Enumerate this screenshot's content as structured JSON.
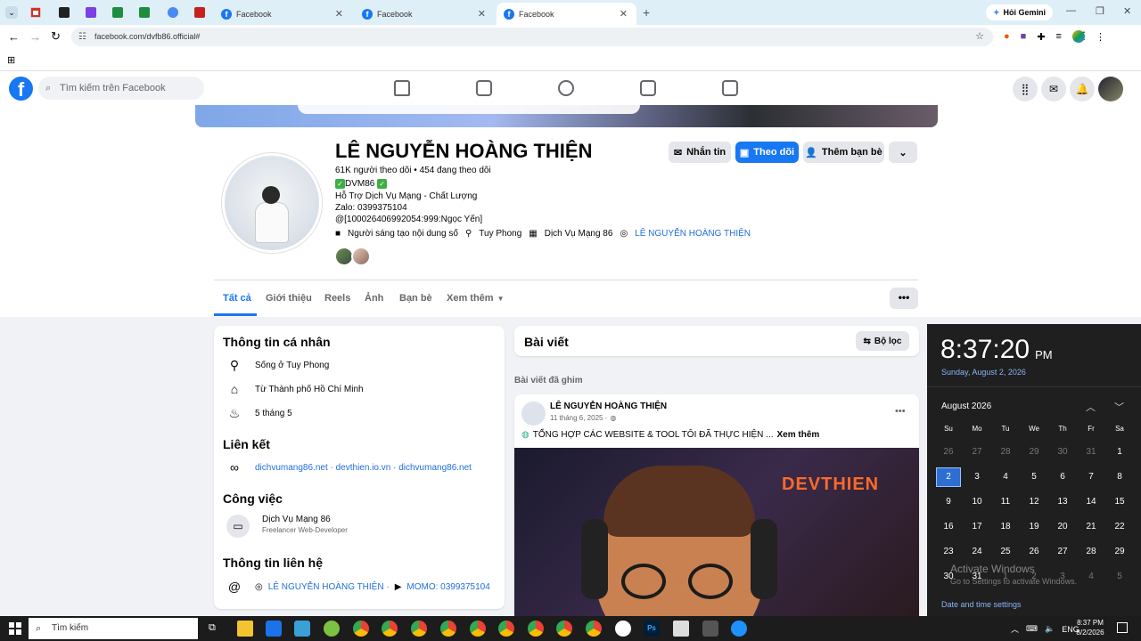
{
  "browser": {
    "tabs": [
      {
        "title": "Facebook",
        "active": false
      },
      {
        "title": "Facebook",
        "active": false
      },
      {
        "title": "Facebook",
        "active": true
      }
    ],
    "gemini_label": "Hỏi Gemini",
    "url": "facebook.com/dvfb86.official#"
  },
  "fb": {
    "search_placeholder": "Tìm kiếm trên Facebook"
  },
  "profile": {
    "name": "LÊ NGUYỄN HOÀNG THIỆN",
    "followers": "61K người theo dõi • 454 đang theo dõi",
    "bio_brand": "DVM86",
    "bio_line2": "Hỗ Trợ Dịch Vụ Mạng - Chất Lượng",
    "bio_line3": "Zalo: 0399375104",
    "bio_line4": "@[100026406992054:999:Ngọc Yến]",
    "meta_creator": "Người sáng tạo nội dung số",
    "meta_place": "Tuy Phong",
    "meta_business": "Dịch Vụ Mạng 86",
    "meta_instagram": "LÊ NGUYỄN HOÀNG THIỆN",
    "btn_message": "Nhắn tin",
    "btn_follow": "Theo dõi",
    "btn_add_friend": "Thêm bạn bè",
    "tabs": [
      "Tất cả",
      "Giới thiệu",
      "Reels",
      "Ảnh",
      "Bạn bè",
      "Xem thêm"
    ],
    "more_dots": "•••"
  },
  "intro": {
    "title": "Thông tin cá nhân",
    "lives": "Sống ở Tuy Phong",
    "from": "Từ Thành phố Hồ Chí Minh",
    "birthday": "5 tháng 5",
    "links_title": "Liên kết",
    "links": "dichvumang86.net · devthien.io.vn · dichvumang86.net",
    "work_title": "Công việc",
    "work_name": "Dịch Vụ Mạng 86",
    "work_role": "Freelancer Web-Developer",
    "contact_title": "Thông tin liên hệ",
    "contact_instagram": "LÊ NGUYỄN HOÀNG THIỆN ·",
    "contact_momo": "MOMO: 0399375104"
  },
  "posts": {
    "title": "Bài viết",
    "filter": "Bộ lọc",
    "pinned_label": "Bài viết đã ghim",
    "author": "LÊ NGUYỄN HOÀNG THIỆN",
    "date": "11 tháng 6, 2025 ·",
    "text": "TỔNG HỢP CÁC WEBSITE & TOOL TÔI ĐÃ THỰC HIỆN ...",
    "see_more": "Xem thêm",
    "image_text": "DEVTHIEN",
    "dots": "•••"
  },
  "clock": {
    "time": "8:37:20",
    "ampm": "PM",
    "date": "Sunday, August 2, 2026",
    "month": "August 2026",
    "weekdays": [
      "Su",
      "Mo",
      "Tu",
      "We",
      "Th",
      "Fr",
      "Sa"
    ],
    "rows": [
      [
        "26",
        "27",
        "28",
        "29",
        "30",
        "31",
        "1"
      ],
      [
        "2",
        "3",
        "4",
        "5",
        "6",
        "7",
        "8"
      ],
      [
        "9",
        "10",
        "11",
        "12",
        "13",
        "14",
        "15"
      ],
      [
        "16",
        "17",
        "18",
        "19",
        "20",
        "21",
        "22"
      ],
      [
        "23",
        "24",
        "25",
        "26",
        "27",
        "28",
        "29"
      ],
      [
        "30",
        "31",
        "1",
        "2",
        "3",
        "4",
        "5"
      ]
    ],
    "activate_title": "Activate Windows",
    "activate_sub": "Go to Settings to activate Windows.",
    "settings_link": "Date and time settings"
  },
  "taskbar": {
    "search": "Tìm kiếm",
    "lang": "ENG",
    "time": "8:37 PM",
    "date": "8/2/2026"
  }
}
